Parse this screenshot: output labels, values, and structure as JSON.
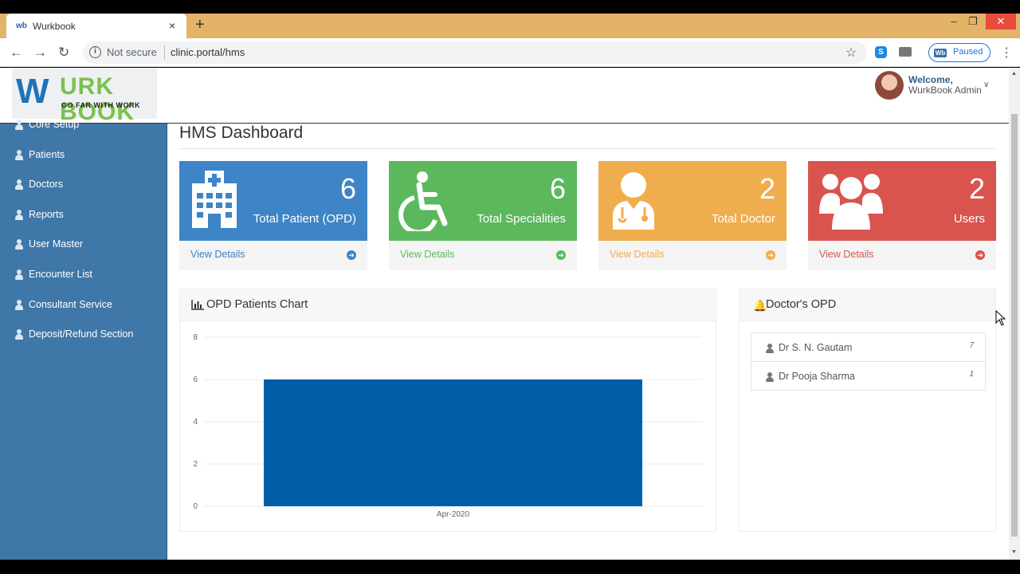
{
  "browser": {
    "tab_title": "Wurkbook",
    "tab_favicon": "wb",
    "tab_close": "×",
    "new_tab": "+",
    "security": "Not secure",
    "url": "clinic.portal/hms",
    "profile_status": "Paused",
    "profile_icon": "Wb",
    "ext_skype": "S",
    "window_controls": {
      "minimize": "–",
      "maximize": "❐",
      "close": "✕"
    }
  },
  "header": {
    "logo_w": "W",
    "logo_text": "URK BOOK",
    "logo_tagline": "GO FAR WITH WORK",
    "welcome": "Welcome,",
    "user_name": "WurkBook Admin"
  },
  "sidebar": {
    "items": [
      {
        "label": "Core Setup",
        "icon": "user-icon"
      },
      {
        "label": "Patients",
        "icon": "user-icon"
      },
      {
        "label": "Doctors",
        "icon": "user-icon"
      },
      {
        "label": "Reports",
        "icon": "user-icon"
      },
      {
        "label": "User Master",
        "icon": "user-icon"
      },
      {
        "label": "Encounter List",
        "icon": "user-icon"
      },
      {
        "label": "Consultant Service",
        "icon": "user-icon"
      },
      {
        "label": "Deposit/Refund Section",
        "icon": "user-icon"
      }
    ]
  },
  "main": {
    "title": "HMS Dashboard",
    "cards": [
      {
        "value": "6",
        "label": "Total Patient (OPD)",
        "link": "View Details",
        "icon": "hospital-icon",
        "color": "#3d85c6",
        "link_color": "#3d85c6"
      },
      {
        "value": "6",
        "label": "Total Specialities",
        "link": "View Details",
        "icon": "wheelchair-icon",
        "color": "#5cb85c",
        "link_color": "#5cb85c"
      },
      {
        "value": "2",
        "label": "Total Doctor",
        "link": "View Details",
        "icon": "doctor-icon",
        "color": "#f0ad4e",
        "link_color": "#f0ad4e"
      },
      {
        "value": "2",
        "label": "Users",
        "link": "View Details",
        "icon": "users-icon",
        "color": "#d9534f",
        "link_color": "#d9534f"
      }
    ],
    "chart_panel_title": "OPD Patients Chart",
    "doctor_panel_title": "Doctor's OPD",
    "doctors": [
      {
        "name": "Dr S. N. Gautam",
        "count": "7"
      },
      {
        "name": "Dr Pooja Sharma",
        "count": "1"
      }
    ]
  },
  "chart_data": {
    "type": "bar",
    "categories": [
      "Apr-2020"
    ],
    "values": [
      6
    ],
    "ylim": [
      0,
      8
    ],
    "yticks": [
      0,
      2,
      4,
      6,
      8
    ],
    "bar_color": "#005ea8",
    "grid": true
  }
}
